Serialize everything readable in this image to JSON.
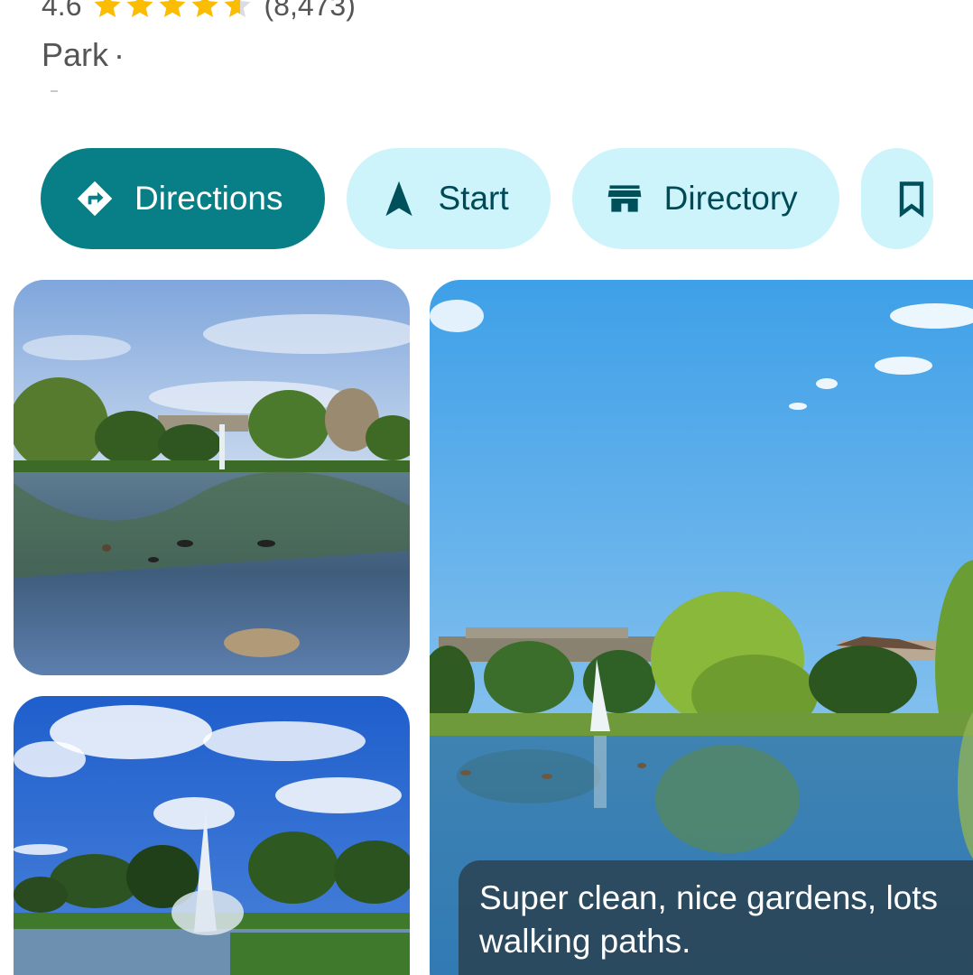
{
  "place": {
    "rating": "4.6",
    "rating_value": 4.6,
    "review_count": "(8,473)",
    "category": "Park",
    "separator": "·"
  },
  "actions": {
    "directions": "Directions",
    "start": "Start",
    "directory": "Directory"
  },
  "photos": {
    "review_line1": "Super clean, nice gardens, lots",
    "review_line2": "walking paths."
  },
  "colors": {
    "accent": "#087f86",
    "chip_bg": "#cdf4fb",
    "chip_text": "#004a57",
    "star": "#fbbc04"
  },
  "icons": {
    "directions": "directions-diamond-icon",
    "start": "navigation-arrow-icon",
    "directory": "storefront-icon",
    "more": "bookmark-icon"
  }
}
